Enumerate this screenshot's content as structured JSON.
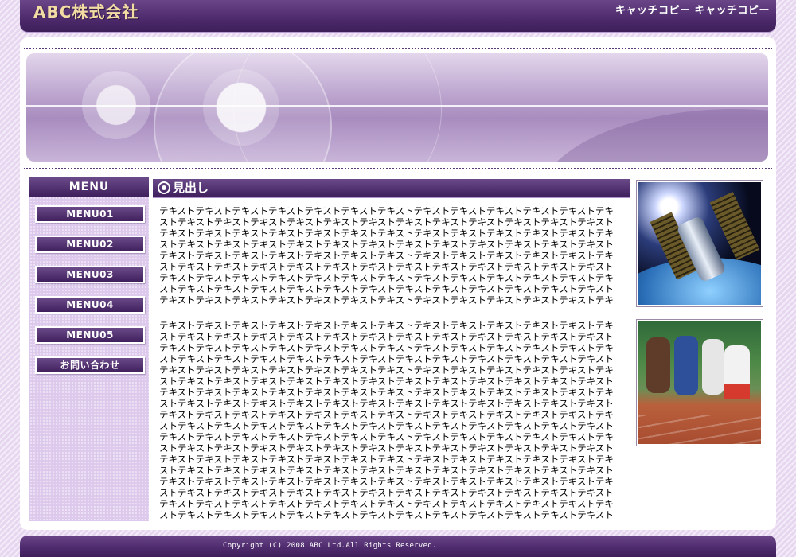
{
  "header": {
    "logo": "ABC株式会社",
    "catchphrase": "キャッチコピー キャッチコピー"
  },
  "sidebar": {
    "title": "MENU",
    "items": [
      {
        "label": "MENU01"
      },
      {
        "label": "MENU02"
      },
      {
        "label": "MENU03"
      },
      {
        "label": "MENU04"
      },
      {
        "label": "MENU05"
      },
      {
        "label": "お問い合わせ"
      }
    ]
  },
  "main": {
    "heading": "見出し",
    "paragraphs": [
      "テキストテキストテキストテキストテキストテキストテキストテキストテキストテキストテキストテキストテキストテキストテキストテキストテキストテキストテキストテキストテキストテキストテキストテキストテキストテキストテキストテキストテキストテキストテキストテキストテキストテキストテキストテキストテキストテキストテキストテキストテキストテキストテキストテキストテキストテキストテキストテキストテキストテキストテキストテキストテキストテキストテキストテキストテキストテキストテキストテキストテキストテキストテキストテキストテキストテキストテキストテキストテキストテキストテキストテキストテキストテキストテキストテキストテキストテキストテキストテキストテキストテキストテキストテキストテキストテキストテキストテキストテキストテキストテキストテキストテキストテキストテキストテキストテキストテキストテキストテキストテキストテキストテキストテキストテキストテキストテキストテキストテキストテキストテキストテキストテキストテキストテキストテキストテキストテキストテキストテキストテキストテキストテキストテキストテキストテキストテキストテキストテキストテキストテキストテキストテキストテキストテキストテキストテキストテキストテキストテキストテキストテキストテキストテキストテキストテキストテキストテキストテキストテキストテキストテキストテキストテキストテキストテキスト",
      "テキストテキストテキストテキストテキストテキストテキストテキストテキストテキストテキストテキストテキストテキストテキストテキストテキストテキストテキストテキストテキストテキストテキストテキストテキストテキストテキストテキストテキストテキストテキストテキストテキストテキストテキストテキストテキストテキストテキストテキストテキストテキストテキストテキストテキストテキストテキストテキストテキストテキストテキストテキストテキストテキストテキストテキストテキストテキストテキストテキストテキストテキストテキストテキストテキストテキストテキストテキストテキストテキストテキストテキストテキストテキストテキストテキストテキストテキストテキストテキストテキストテキストテキストテキストテキストテキストテキストテキストテキストテキストテキストテキストテキストテキストテキストテキストテキストテキストテキストテキストテキストテキストテキストテキストテキストテキストテキストテキストテキストテキストテキストテキストテキストテキストテキストテキストテキストテキストテキストテキストテキストテキストテキストテキストテキストテキストテキストテキストテキストテキストテキストテキストテキストテキストテキストテキストテキストテキストテキストテキストテキストテキストテキストテキストテキストテキストテキストテキストテキストテキストテキストテキストテキストテキストテキストテキストテキストテキストテキストテキストテキストテキストテキストテキストテキストテキストテキストテキストテキストテキストテキストテキストテキストテキストテキストテキストテキストテキストテキストテキストテキストテキストテキストテキストテキストテキストテキストテキストテキストテキストテキストテキストテキストテキストテキストテキストテキストテキストテキストテキストテキストテキストテキストテキストテキストテキストテキストテキストテキストテキストテキストテキストテキストテキストテキストテキストテキストテキストテキストテキストテキストテキストテキストテキストテキストテキストテキストテキストテキストテキストテキストテキストテキストテキストテキストテキストテキストテキストテキストテキストテキストテキストテキストテキストテキストテキストテキストテキストテキストテキストテキストテキストテキストテキストテキストテキストテキストテキストテキストテキストテキストテキストテキストテキストテキストテキストテキストテキストテキストテキストテキストテキストテキストテキストテキストテキストテキストテキストテキストテキストテキストテキストテキストテキストテキストテキストテキストテキストテキストテキストテキストテキストテキストテキストテキストテキストテキストテキストテキスト"
    ]
  },
  "footer": {
    "copyright": "Copyright (C) 2008 ABC Ltd.All Rights Reserved."
  },
  "colors": {
    "brand": "#4d2a6c",
    "logo_text": "#f2dca4",
    "sidebar_bg": "#dcc9ec"
  }
}
